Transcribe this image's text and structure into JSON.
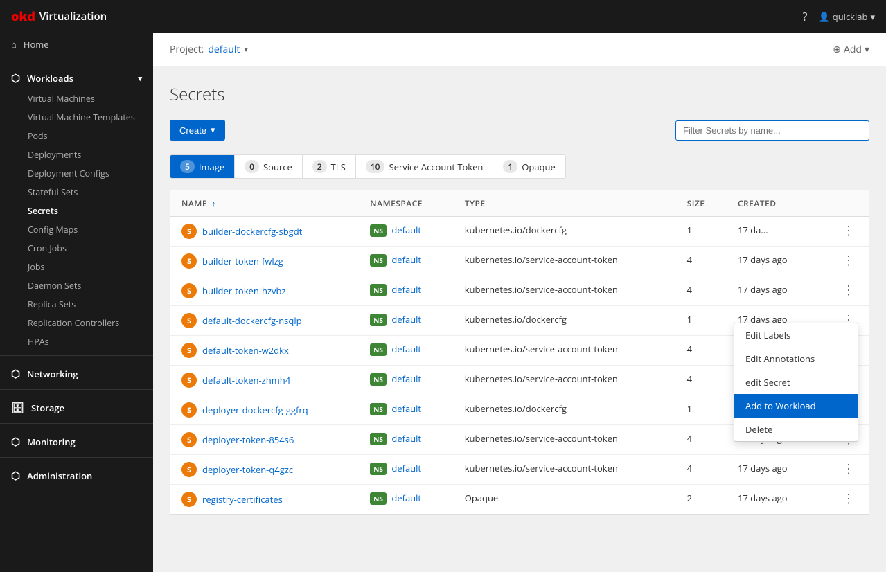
{
  "topNav": {
    "logoMark": "okd",
    "appName": "Virtualization",
    "helpIcon": "?",
    "user": "quicklab",
    "userChevron": "▾"
  },
  "project": {
    "label": "Project:",
    "name": "default",
    "chevron": "▾",
    "addLabel": "Add",
    "addChevron": "▾"
  },
  "sidebar": {
    "home": "Home",
    "workloads": "Workloads",
    "workloadItems": [
      "Virtual Machines",
      "Virtual Machine Templates",
      "Pods",
      "Deployments",
      "Deployment Configs",
      "Stateful Sets",
      "Secrets",
      "Config Maps",
      "Cron Jobs",
      "Jobs",
      "Daemon Sets",
      "Replica Sets",
      "Replication Controllers",
      "HPAs"
    ],
    "networking": "Networking",
    "storage": "Storage",
    "monitoring": "Monitoring",
    "administration": "Administration"
  },
  "page": {
    "title": "Secrets"
  },
  "toolbar": {
    "createLabel": "Create",
    "createChevron": "▾",
    "filterPlaceholder": "Filter Secrets by name..."
  },
  "filterTabs": [
    {
      "count": "5",
      "label": "Image",
      "active": true
    },
    {
      "count": "0",
      "label": "Source",
      "active": false
    },
    {
      "count": "2",
      "label": "TLS",
      "active": false
    },
    {
      "count": "10",
      "label": "Service Account Token",
      "active": false
    },
    {
      "count": "1",
      "label": "Opaque",
      "active": false
    }
  ],
  "tableHeaders": [
    "NAME",
    "NAMESPACE",
    "TYPE",
    "SIZE",
    "CREATED"
  ],
  "secrets": [
    {
      "name": "builder-dockercfg-sbgdt",
      "iconColor": "orange",
      "iconLabel": "S",
      "namespace": "default",
      "type": "kubernetes.io/dockercfg",
      "size": "1",
      "created": "17 da..."
    },
    {
      "name": "builder-token-fwlzg",
      "iconColor": "orange",
      "iconLabel": "S",
      "namespace": "default",
      "type": "kubernetes.io/service-account-token",
      "size": "4",
      "created": "17 days ago"
    },
    {
      "name": "builder-token-hzvbz",
      "iconColor": "orange",
      "iconLabel": "S",
      "namespace": "default",
      "type": "kubernetes.io/service-account-token",
      "size": "4",
      "created": "17 days ago"
    },
    {
      "name": "default-dockercfg-nsqlp",
      "iconColor": "orange",
      "iconLabel": "S",
      "namespace": "default",
      "type": "kubernetes.io/dockercfg",
      "size": "1",
      "created": "17 days ago"
    },
    {
      "name": "default-token-w2dkx",
      "iconColor": "orange",
      "iconLabel": "S",
      "namespace": "default",
      "type": "kubernetes.io/service-account-token",
      "size": "4",
      "created": "17 days ago"
    },
    {
      "name": "default-token-zhmh4",
      "iconColor": "orange",
      "iconLabel": "S",
      "namespace": "default",
      "type": "kubernetes.io/service-account-token",
      "size": "4",
      "created": "17 days ago"
    },
    {
      "name": "deployer-dockercfg-ggfrq",
      "iconColor": "orange",
      "iconLabel": "S",
      "namespace": "default",
      "type": "kubernetes.io/dockercfg",
      "size": "1",
      "created": "17 days ago"
    },
    {
      "name": "deployer-token-854s6",
      "iconColor": "orange",
      "iconLabel": "S",
      "namespace": "default",
      "type": "kubernetes.io/service-account-token",
      "size": "4",
      "created": "17 days ago"
    },
    {
      "name": "deployer-token-q4gzc",
      "iconColor": "orange",
      "iconLabel": "S",
      "namespace": "default",
      "type": "kubernetes.io/service-account-token",
      "size": "4",
      "created": "17 days ago"
    },
    {
      "name": "registry-certificates",
      "iconColor": "orange",
      "iconLabel": "S",
      "namespace": "default",
      "type": "Opaque",
      "size": "2",
      "created": "17 days ago"
    }
  ],
  "contextMenu": {
    "items": [
      {
        "label": "Edit Labels",
        "highlighted": false
      },
      {
        "label": "Edit Annotations",
        "highlighted": false
      },
      {
        "label": "edit Secret",
        "highlighted": false
      },
      {
        "label": "Add to Workload",
        "highlighted": true
      },
      {
        "label": "Delete",
        "highlighted": false
      }
    ]
  }
}
